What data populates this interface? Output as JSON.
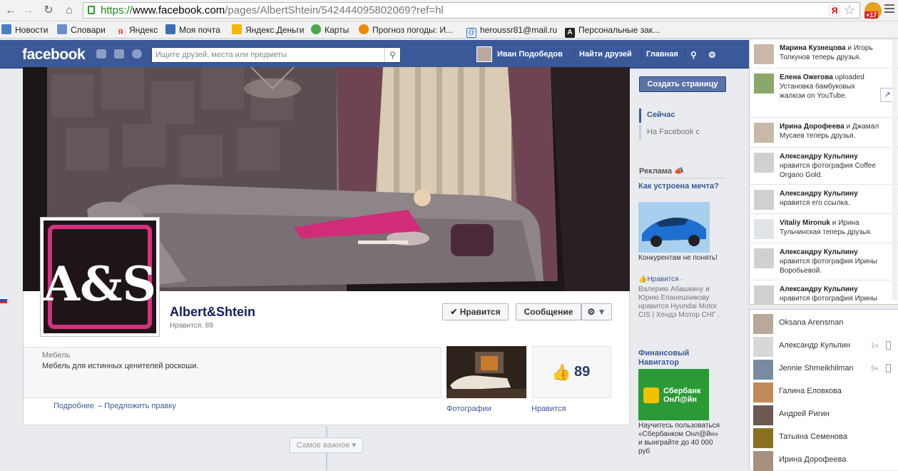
{
  "browser": {
    "url_scheme": "https://",
    "url_domain": "www.facebook.com",
    "url_path": "/pages/AlbertShtein/542444095802069?ref=hl",
    "notification_badge": "+17",
    "bookmarks": [
      {
        "label": "Новости",
        "icon": "news-icon",
        "color": "#4a7fc1"
      },
      {
        "label": "Словари",
        "icon": "dictionary-icon",
        "color": "#6a8fc7"
      },
      {
        "label": "Яндекс",
        "icon": "yandex-icon",
        "color": "#e22"
      },
      {
        "label": "Моя почта",
        "icon": "mail-icon",
        "color": "#3a6fb0"
      },
      {
        "label": "Яндекс.Деньги",
        "icon": "money-icon",
        "color": "#f7b500"
      },
      {
        "label": "Карты",
        "icon": "maps-icon",
        "color": "#4aa84a"
      },
      {
        "label": "Прогноз погоды: И...",
        "icon": "weather-icon",
        "color": "#f08a00"
      },
      {
        "label": "heroussr81@mail.ru",
        "icon": "at-icon",
        "color": "#2a6bbf"
      },
      {
        "label": "Персональные зак...",
        "icon": "a-icon",
        "color": "#222"
      }
    ]
  },
  "fb": {
    "logo": "facebook",
    "search_placeholder": "Ищите друзей, места или предметы",
    "user_name": "Иван Подобедов",
    "find_friends": "Найти друзей",
    "home": "Главная"
  },
  "page": {
    "name": "Albert&Shtein",
    "likes_label": "Нравится: 89",
    "like_button": "✔ Нравится",
    "message_button": "Сообщение",
    "category": "Мебель",
    "description": "Мебель для истинных ценителей роскоши.",
    "more_link": "Подробнее",
    "edit_link": "– Предложить правку",
    "photos_label": "Фотографии",
    "likes_box_count": "89",
    "likes_box_label": "Нравится",
    "sort_label": "Самое важное",
    "logo_text": "A&S"
  },
  "right": {
    "create_page": "Создать страницу",
    "now": "Сейчас",
    "on_facebook": "На Facebook с",
    "ads_header": "Реклама",
    "ad1_title": "Как устроена мечта?",
    "ad1_text": "Конкурентам не понять!",
    "ad1_like": "Нравится",
    "ad1_social": "Валерию Абашкину и Юрию Епанешникову нравится Hyundai Motor CIS | Хендэ Мотор СНГ .",
    "ad2_title": "Финансовый Навигатор",
    "ad2_logo_line1": "Сбербанк",
    "ad2_logo_line2": "ОнЛ@йн",
    "ad2_text": "Научитесь пользоваться «Сбербанком Онл@йн» и выиграйте до 40 000 руб"
  },
  "ticker": [
    {
      "bold": "Марина Кузнецова",
      "text": " и Игорь Толкунов теперь друзья."
    },
    {
      "bold": "Елена Ожегова",
      "text": " uploaded Установка бамбуковых жалюзи on YouTube."
    },
    {
      "bold": "Ирина Дорофеева",
      "text": " и Джамал Мусаев теперь друзья."
    },
    {
      "bold": "Александру Кульпину",
      "text": " нравится фотография Coffee Organo Gold."
    },
    {
      "bold": "Александру Кульпину",
      "text": " нравится его ссылка."
    },
    {
      "bold": "Vitaliy Mironuk",
      "text": " и Ирина Тульчинская теперь друзья."
    },
    {
      "bold": "Александру Кульпину",
      "text": " нравится фотография Ирины Воробьевой."
    },
    {
      "bold": "Александру Кульпину",
      "text": " нравится фотография Ирины"
    }
  ],
  "chat": [
    {
      "name": "Oksana Arensman",
      "ago": ""
    },
    {
      "name": "Александр Кульпин",
      "ago": "1ч"
    },
    {
      "name": "Jennie Shmeikhilman",
      "ago": "5ч"
    },
    {
      "name": "Галина Еловкова",
      "ago": ""
    },
    {
      "name": "Андрей Ригин",
      "ago": ""
    },
    {
      "name": "Татьяна Семенова",
      "ago": ""
    },
    {
      "name": "Ирина Дорофеева",
      "ago": ""
    }
  ]
}
